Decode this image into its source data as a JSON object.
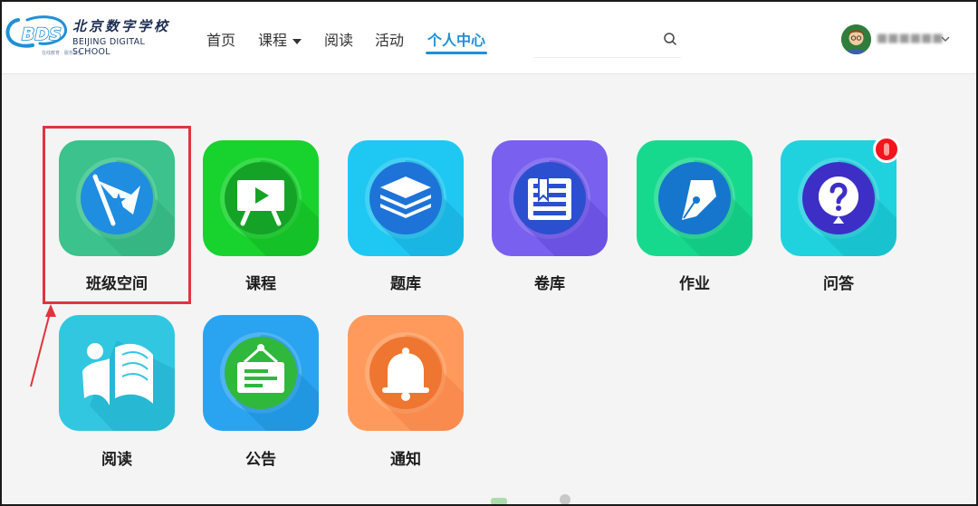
{
  "header": {
    "logo": {
      "mark": "BDS",
      "name_cn": "北京数字学校",
      "name_en": "BEIJING DIGITAL SCHOOL",
      "tagline": "在线教育 · 服务学生"
    },
    "nav": [
      {
        "label": "首页",
        "active": false
      },
      {
        "label": "课程",
        "active": false,
        "dropdown": true
      },
      {
        "label": "阅读",
        "active": false
      },
      {
        "label": "活动",
        "active": false
      },
      {
        "label": "个人中心",
        "active": true
      }
    ],
    "search": {
      "placeholder": "",
      "value": "",
      "icon": "search-icon"
    },
    "user": {
      "name": "■■■■■■",
      "avatar": "avatar-icon",
      "menu_icon": "chevron-down-icon"
    }
  },
  "colors": {
    "accent": "#1e90d6",
    "highlight_box": "#e0353b",
    "badge": "#f3141c"
  },
  "apps": [
    {
      "label": "班级空间",
      "icon": "flag-icon",
      "highlighted": true,
      "badge": false
    },
    {
      "label": "课程",
      "icon": "presentation-board-icon",
      "highlighted": false,
      "badge": false
    },
    {
      "label": "题库",
      "icon": "layers-icon",
      "highlighted": false,
      "badge": false
    },
    {
      "label": "卷库",
      "icon": "bookshelf-icon",
      "highlighted": false,
      "badge": false
    },
    {
      "label": "作业",
      "icon": "pen-icon",
      "highlighted": false,
      "badge": false
    },
    {
      "label": "问答",
      "icon": "question-bubble-icon",
      "highlighted": false,
      "badge": true
    },
    {
      "label": "阅读",
      "icon": "reader-book-icon",
      "highlighted": false,
      "badge": false
    },
    {
      "label": "公告",
      "icon": "notice-board-icon",
      "highlighted": false,
      "badge": false
    },
    {
      "label": "通知",
      "icon": "bell-icon",
      "highlighted": false,
      "badge": false
    }
  ]
}
